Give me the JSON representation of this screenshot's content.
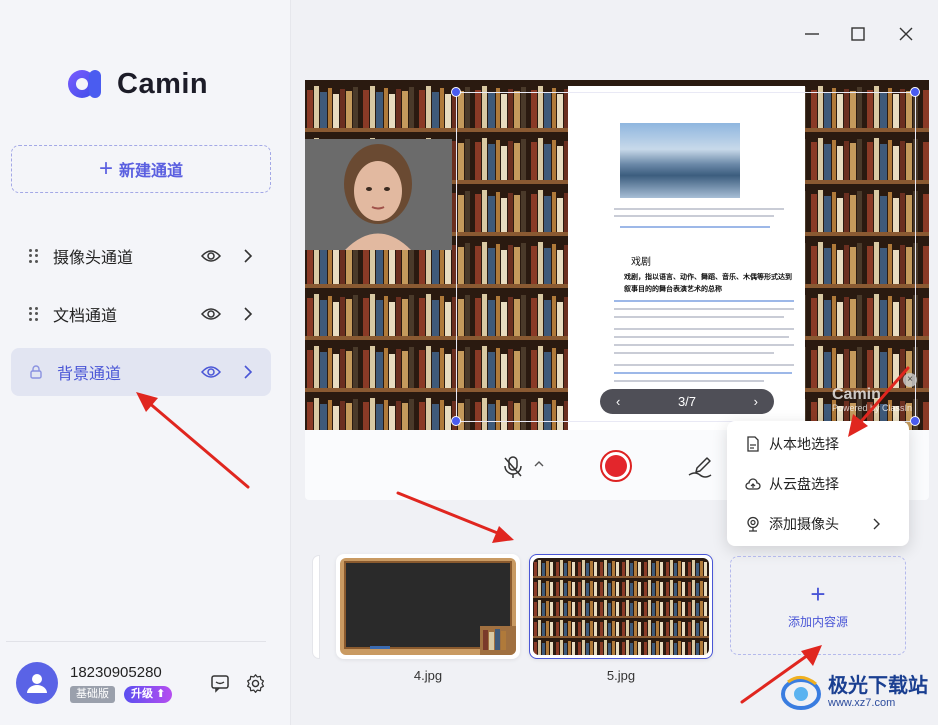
{
  "app": {
    "name": "Camin"
  },
  "sidebar": {
    "new_channel_label": "新建通道",
    "channels": [
      {
        "label": "摄像头通道",
        "active": false
      },
      {
        "label": "文档通道",
        "active": false
      },
      {
        "label": "背景通道",
        "active": true
      }
    ]
  },
  "user": {
    "phone": "18230905280",
    "plan_badge": "基础版",
    "upgrade_badge": "升级"
  },
  "preview": {
    "page_indicator": "3/7",
    "watermark_name": "Camin",
    "watermark_sub": "Powered by ClassIn",
    "doc_title": "戏剧",
    "doc_subtitle": "戏剧，指以语言、动作、舞蹈、音乐、木偶等形式达到叙事目的的舞台表演艺术的总称"
  },
  "add_menu": {
    "items": [
      {
        "label": "从本地选择",
        "icon": "file-icon"
      },
      {
        "label": "从云盘选择",
        "icon": "cloud-icon"
      },
      {
        "label": "添加摄像头",
        "icon": "camera-icon",
        "has_submenu": true
      }
    ]
  },
  "thumbnails": [
    {
      "filename": "4.jpg",
      "selected": false
    },
    {
      "filename": "5.jpg",
      "selected": true
    }
  ],
  "add_content_label": "添加内容源",
  "site_watermark": {
    "title": "极光下载站",
    "url": "www.xz7.com"
  },
  "colors": {
    "accent": "#4a56d6",
    "record": "#e3262c",
    "annotation": "#e0261f"
  }
}
